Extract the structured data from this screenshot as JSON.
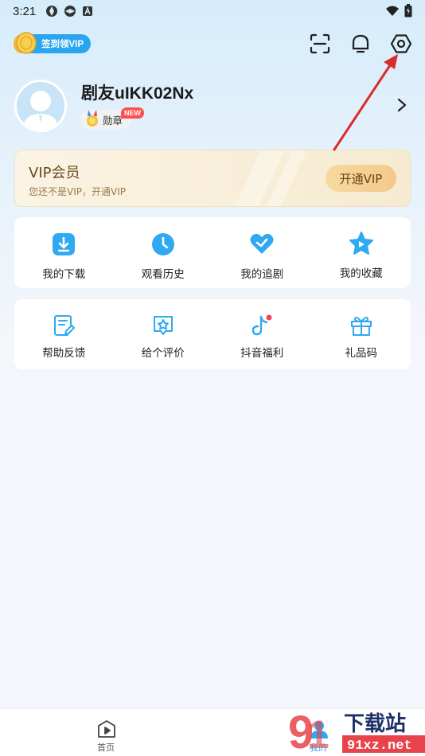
{
  "status_bar": {
    "time": "3:21"
  },
  "header": {
    "signin_badge_label": "签到领VIP"
  },
  "profile": {
    "username": "剧友uIKK02Nx",
    "medal_label": "勋章",
    "new_tag": "NEW"
  },
  "vip_card": {
    "title": "VIP会员",
    "subtitle": "您还不是VIP，开通VIP",
    "button_label": "开通VIP"
  },
  "primary_grid": [
    {
      "label": "我的下载",
      "icon": "download-icon"
    },
    {
      "label": "观看历史",
      "icon": "clock-icon"
    },
    {
      "label": "我的追剧",
      "icon": "heart-check-icon"
    },
    {
      "label": "我的收藏",
      "icon": "star-icon"
    }
  ],
  "secondary_grid": [
    {
      "label": "帮助反馈",
      "icon": "feedback-icon"
    },
    {
      "label": "给个评价",
      "icon": "rate-icon"
    },
    {
      "label": "抖音福利",
      "icon": "tiktok-icon"
    },
    {
      "label": "礼品码",
      "icon": "gift-icon"
    }
  ],
  "bottom_nav": [
    {
      "label": "首页",
      "icon": "home-play-icon"
    },
    {
      "label": "我的",
      "icon": "profile-icon"
    }
  ],
  "watermark": {
    "text": "下载站",
    "url_text": "91xz.net"
  },
  "colors": {
    "accent_blue": "#2aa6f0",
    "vip_gold": "#f3c98a",
    "annotation_red": "#d92b2b"
  }
}
